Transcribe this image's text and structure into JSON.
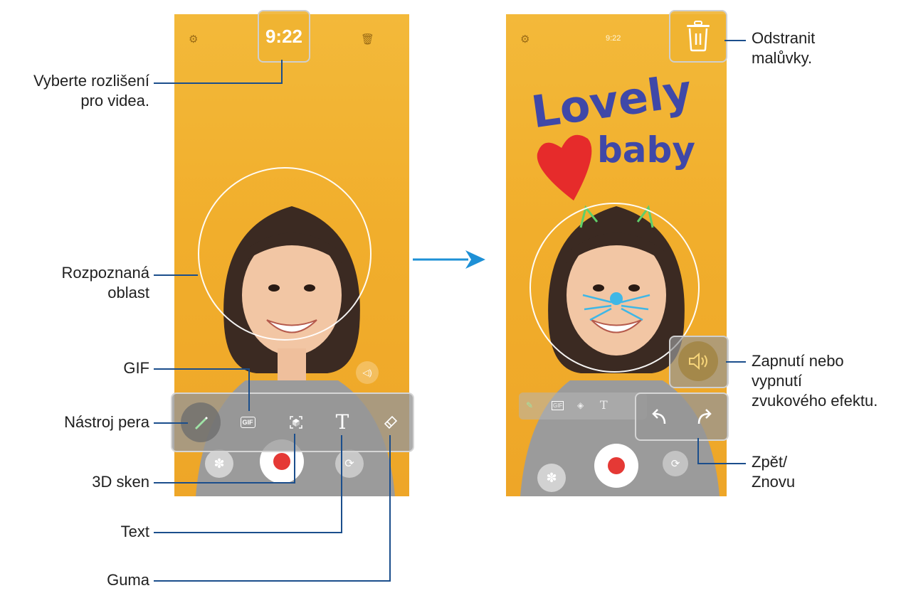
{
  "left_phone": {
    "time": "9:22",
    "settings_icon": "gear-icon",
    "trash_icon": "trash-icon"
  },
  "right_phone": {
    "time": "9:22",
    "drawing_text": [
      "Lovely",
      "baby"
    ],
    "settings_icon": "gear-icon"
  },
  "toolbar": {
    "gif_label": "GIF",
    "text_tool": "T",
    "items": [
      "pen-icon",
      "gif-icon",
      "3d-scan-icon",
      "text-icon",
      "eraser-icon"
    ]
  },
  "callouts": {
    "resolution": [
      "Vyberte rozlišení",
      "pro videa."
    ],
    "recognized": [
      "Rozpoznaná",
      "oblast"
    ],
    "gif": "GIF",
    "pen": "Nástroj pera",
    "scan": "3D sken",
    "text": "Text",
    "eraser": "Guma",
    "delete": [
      "Odstranit",
      "malůvky."
    ],
    "sound": [
      "Zapnutí nebo",
      "vypnutí",
      "zvukového efektu."
    ],
    "undo": [
      "Zpět/",
      "Znovu"
    ]
  },
  "colors": {
    "line": "#1b4e8c",
    "background_yellow": "#f1ae2c",
    "record": "#e53935",
    "arrow": "#1e90d6"
  }
}
